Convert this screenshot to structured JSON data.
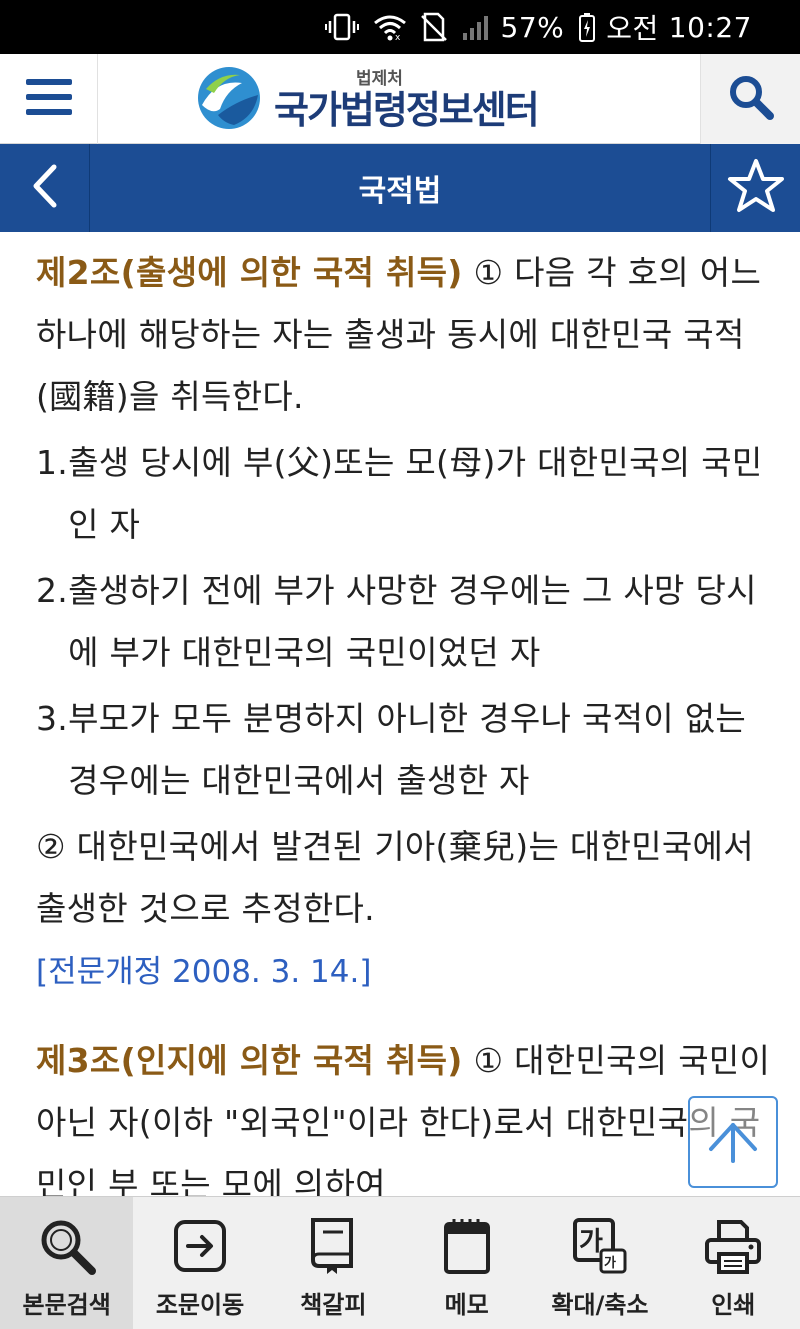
{
  "status_bar": {
    "battery": "57%",
    "ampm": "오전",
    "time": "10:27"
  },
  "header": {
    "logo_sub": "법제처",
    "logo_main": "국가법령정보센터"
  },
  "title_bar": {
    "title": "국적법"
  },
  "content": {
    "article2": {
      "heading": "제2조(출생에 의한 국적 취득)",
      "para1": "① 다음 각 호의 어느 하나에 해당하는 자는 출생과 동시에 대한민국 국적(國籍)을 취득한다.",
      "items": [
        {
          "num": "1.",
          "text": "출생 당시에 부(父)또는 모(母)가 대한민국의 국민인 자"
        },
        {
          "num": "2.",
          "text": "출생하기 전에 부가 사망한 경우에는 그 사망 당시에 부가 대한민국의 국민이었던 자"
        },
        {
          "num": "3.",
          "text": "부모가 모두 분명하지 아니한 경우나 국적이 없는 경우에는 대한민국에서 출생한 자"
        }
      ],
      "para2": "② 대한민국에서 발견된 기아(棄兒)는 대한민국에서 출생한 것으로 추정한다.",
      "amendment": "[전문개정 2008. 3. 14.]"
    },
    "article3": {
      "heading": "제3조(인지에 의한 국적 취득)",
      "para1": "① 대한민국의 국민이 아닌 자(이하 \"외국인\"이라 한다)로서 대한민국의 국민인 부 또는 모에 의하여"
    }
  },
  "toolbar": {
    "items": [
      {
        "label": "본문검색",
        "icon": "magnifier-icon"
      },
      {
        "label": "조문이동",
        "icon": "arrow-box-icon"
      },
      {
        "label": "책갈피",
        "icon": "bookmark-book-icon"
      },
      {
        "label": "메모",
        "icon": "memo-pad-icon"
      },
      {
        "label": "확대/축소",
        "icon": "font-size-icon"
      },
      {
        "label": "인쇄",
        "icon": "printer-icon"
      }
    ],
    "zoom_glyph_large": "가",
    "zoom_glyph_small": "가"
  }
}
